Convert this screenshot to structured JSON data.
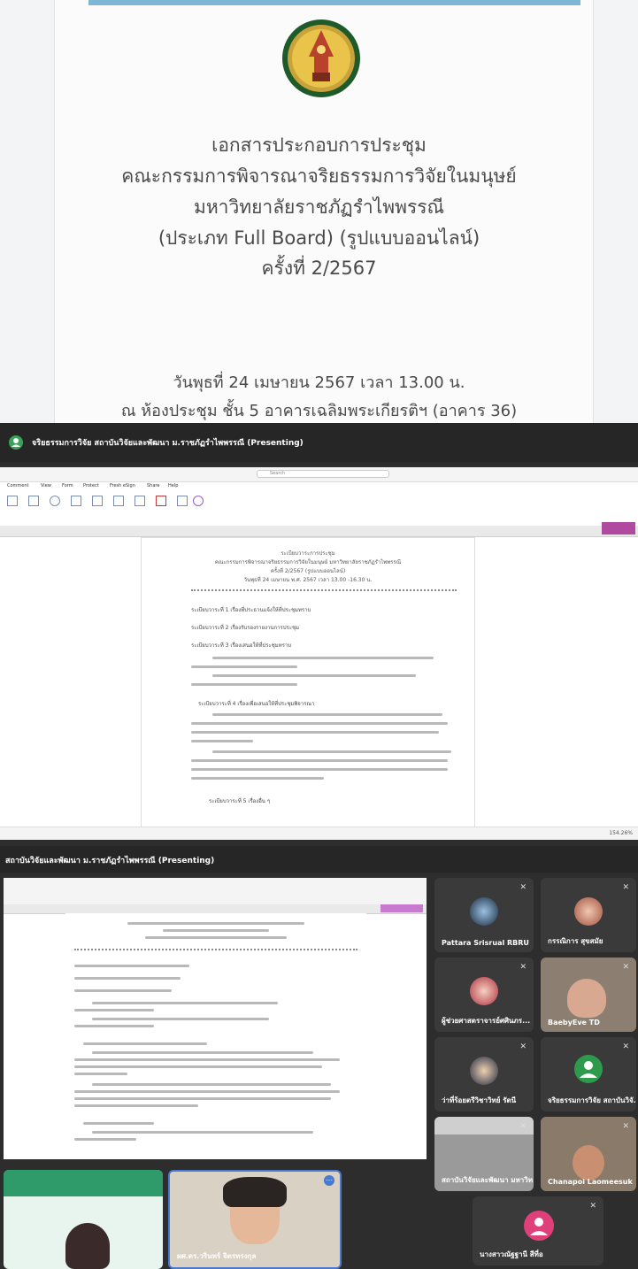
{
  "cover": {
    "lines": [
      "เอกสารประกอบการประชุม",
      "คณะกรรมการพิจารณาจริยธรรมการวิจัยในมนุษย์",
      "มหาวิทยาลัยราชภัฏรำไพพรรณี",
      "(ประเภท Full Board) (รูปแบบออนไลน์)",
      "ครั้งที่ 2/2567"
    ],
    "date_line": "วันพุธที่ 24 เมษายน 2567 เวลา 13.00 น.",
    "place_line": "ณ ห้องประชุม ชั้น 5 อาคารเฉลิมพระเกียรติฯ (อาคาร 36)"
  },
  "share1": {
    "presenter": "จริยธรรมการวิจัย สถาบันวิจัยและพัฒนา ม.ราชภัฏรำไพพรรณี (Presenting)",
    "menu": [
      "Comment",
      "View",
      "Form",
      "Protect",
      "Fresh eSign",
      "Share",
      "Help"
    ],
    "search": "Search",
    "doc_title": "ระเบียบวาระการประชุม",
    "doc_sub": "คณะกรรมการพิจารณาจริยธรรมการวิจัยในมนุษย์ มหาวิทยาลัยราชภัฏรำไพพรรณี",
    "doc_round": "ครั้งที่ 2/2567 (รูปแบบออนไลน์)",
    "doc_date": "วันพุธที่ 24 เมษายน พ.ศ. 2567 เวลา 13.00 -16.30 น.",
    "agenda": [
      "ระเบียบวาระที่ 1  เรื่องที่ประธานแจ้งให้ที่ประชุมทราบ",
      "ระเบียบวาระที่ 2  เรื่องรับรองรายงานการประชุม",
      "ระเบียบวาระที่ 3  เรื่องเสนอให้ที่ประชุมทราบ",
      "ระเบียบวาระที่ 4  เรื่องเพื่อเสนอให้ที่ประชุมพิจารณา",
      "ระเบียบวาระที่ 5  เรื่องอื่น ๆ"
    ],
    "zoom": "154.26%"
  },
  "meeting": {
    "presenter": "สถาบันวิจัยและพัฒนา ม.ราชภัฏรำไพพรรณี (Presenting)",
    "participants": [
      {
        "name": "Pattara Srisrual RBRU",
        "color": "#3a3a3a"
      },
      {
        "name": "กรรณิการ สุขสมัย",
        "color": "#3a3a3a"
      },
      {
        "name": "ผู้ช่วยศาสตราจารย์ศศินภร...",
        "color": "#3a3a3a"
      },
      {
        "name": "BaebyEve TD",
        "color": "#7a6a5a"
      },
      {
        "name": "ว่าที่ร้อยตรีวิชาวิทย์ รัตนี",
        "color": "#3a3a3a"
      },
      {
        "name": "จริยธรรมการวิจัย สถาบันวิจั...",
        "color": "#3a3a3a"
      },
      {
        "name": "สถาบันวิจัยและพัฒนา มหาวิท...",
        "color": "#8a8a8a"
      },
      {
        "name": "Chanapoi Laomeesuk",
        "color": "#8a7a6a"
      },
      {
        "name": "นางสาวณัฐฐานี สีที่อ",
        "color": "#3a3a3a"
      },
      {
        "name": "ผศ.ดร.วรินทร์ จิตรทรงกุล",
        "color": "#8a8270"
      }
    ]
  }
}
